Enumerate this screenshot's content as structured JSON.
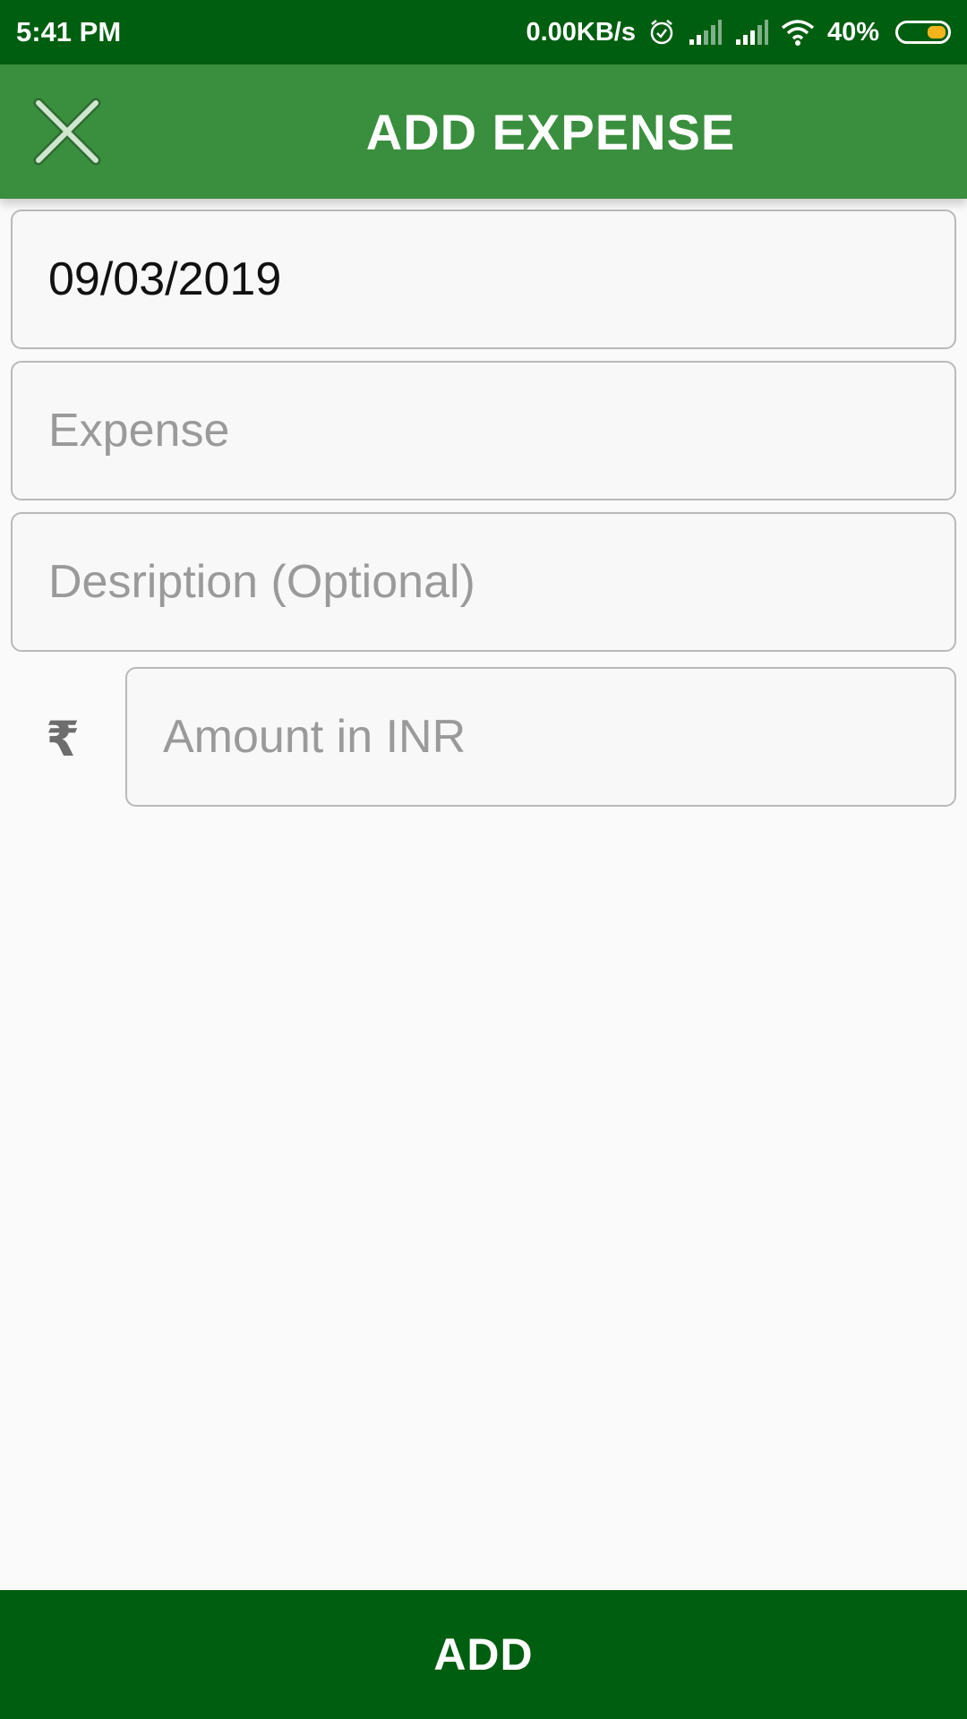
{
  "status_bar": {
    "time": "5:41 PM",
    "network_speed": "0.00KB/s",
    "battery": "40%",
    "battery_level": 0.4,
    "icons": [
      "alarm-icon",
      "signal-icon",
      "signal-icon",
      "wifi-icon",
      "battery-icon"
    ],
    "colors": {
      "background": "#005e10",
      "battery_fill": "#f4b51c"
    }
  },
  "app_bar": {
    "title": "ADD EXPENSE",
    "close_icon": "close-icon",
    "color": "#3a8f3e"
  },
  "form": {
    "date": {
      "value": "09/03/2019"
    },
    "expense": {
      "placeholder": "Expense"
    },
    "description": {
      "placeholder": "Desription (Optional)"
    },
    "amount": {
      "placeholder": "Amount in INR",
      "currency_symbol": "₹"
    }
  },
  "footer": {
    "add_label": "ADD",
    "color": "#005e10"
  }
}
